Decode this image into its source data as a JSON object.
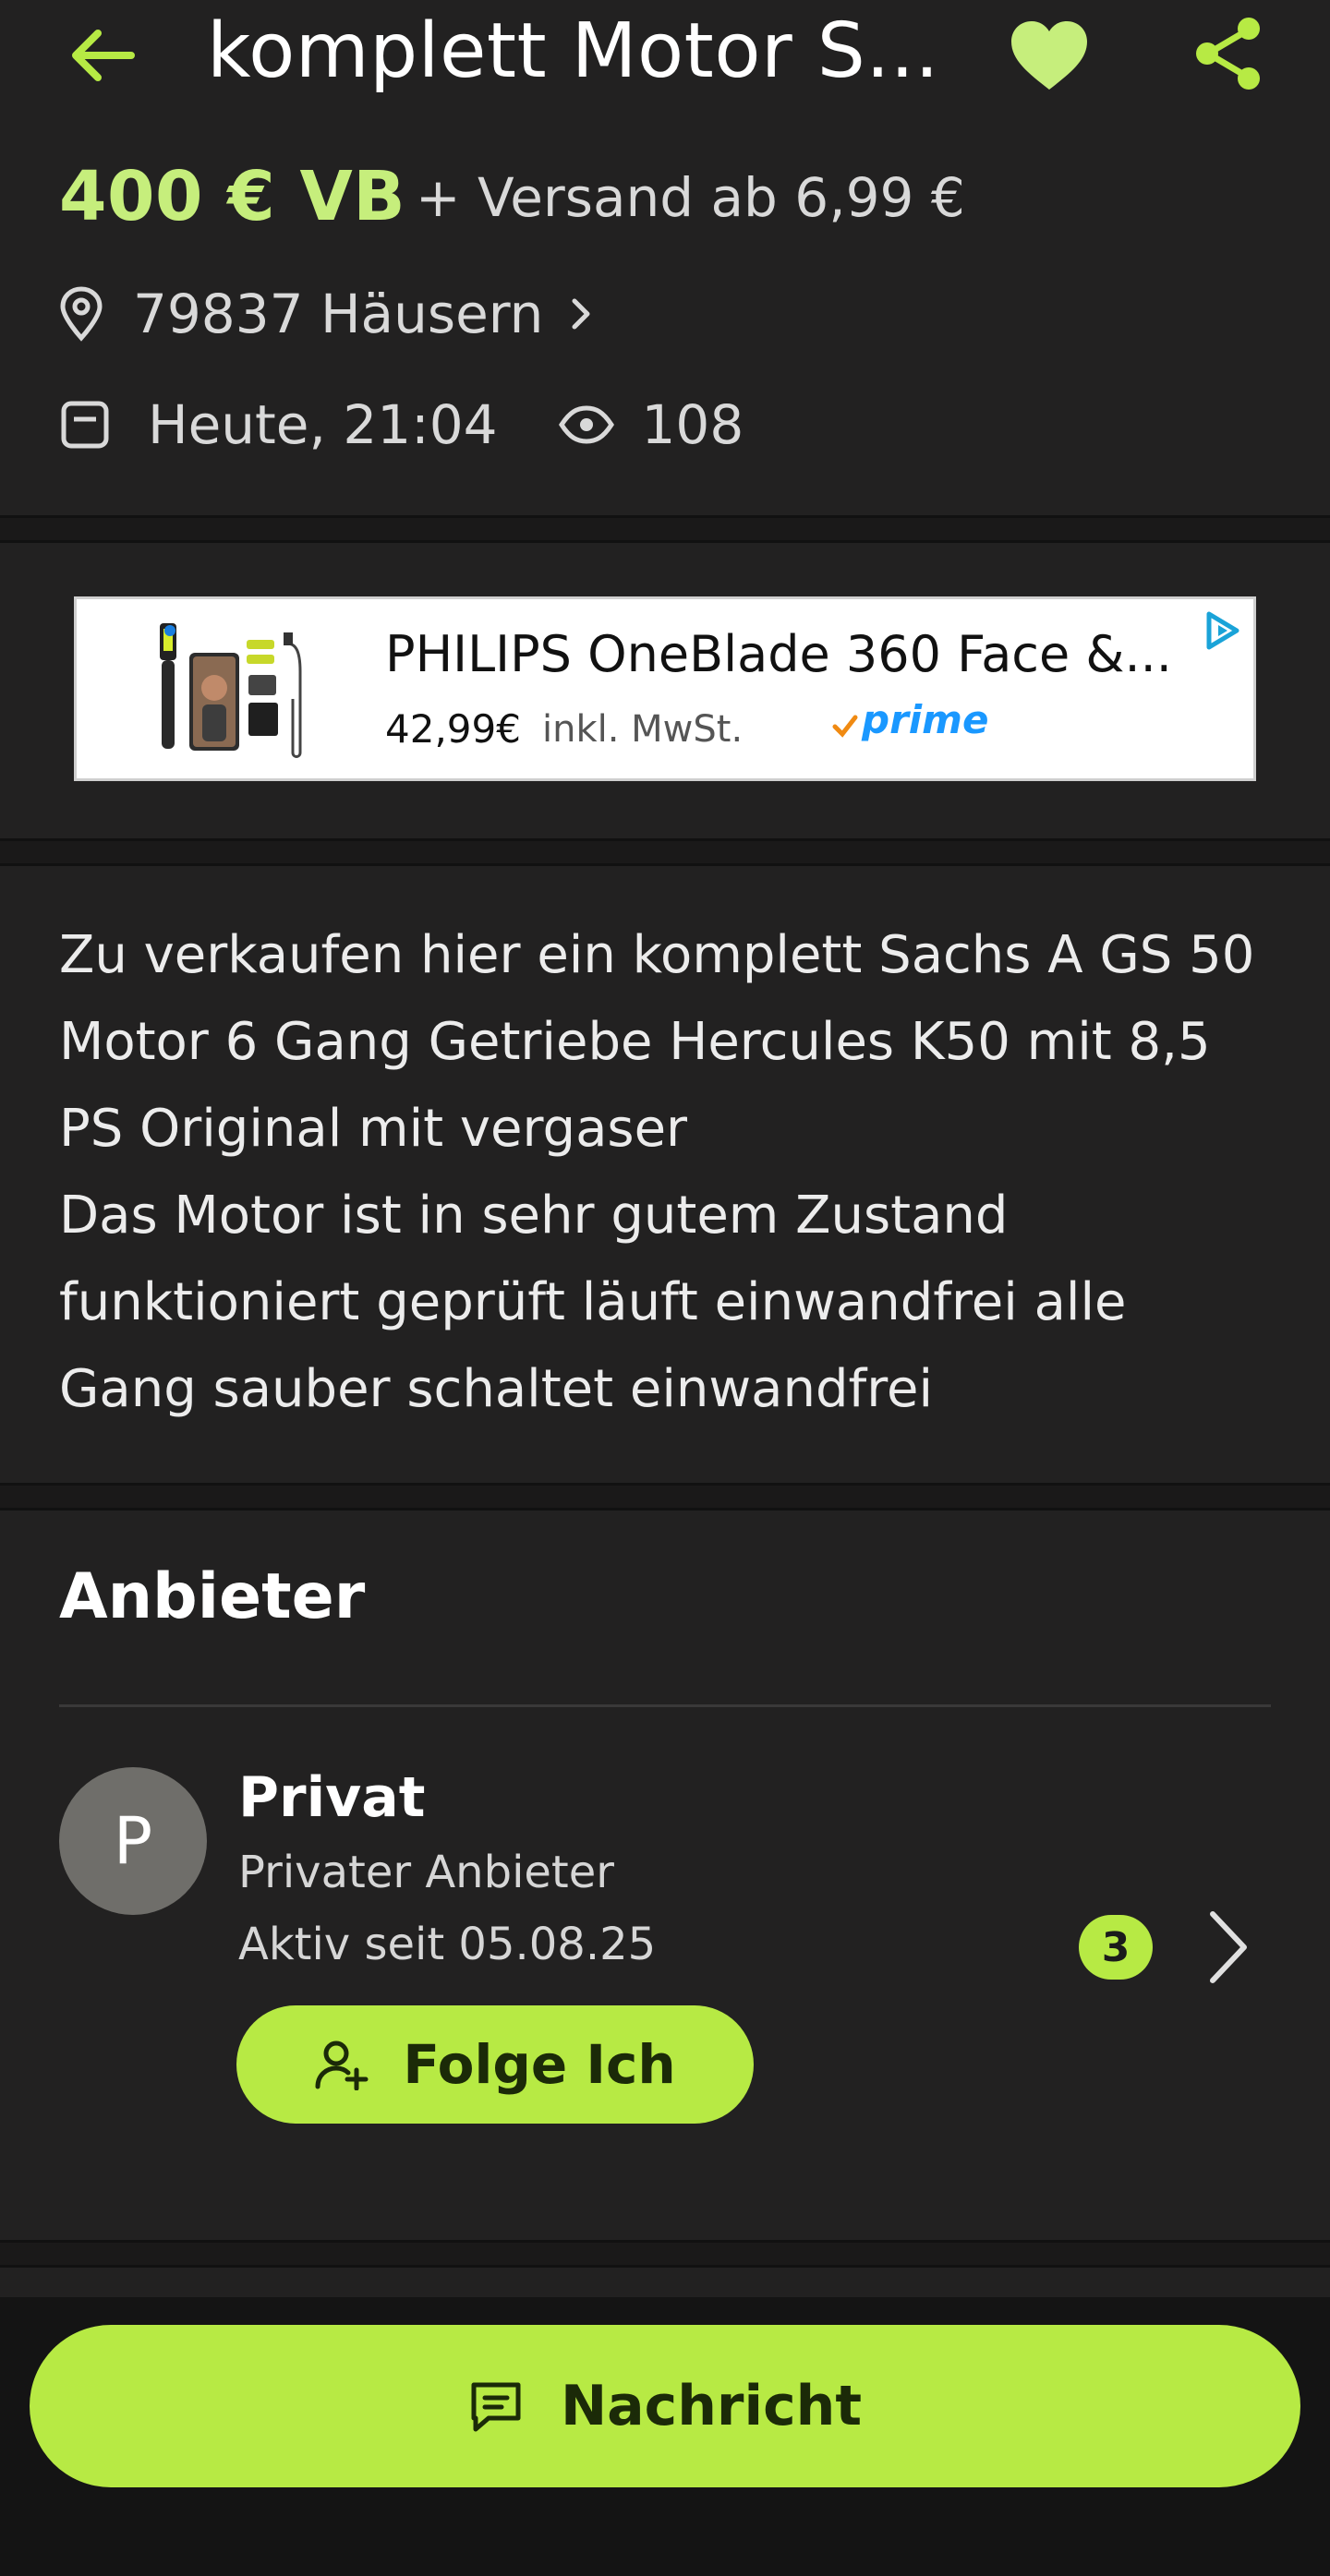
{
  "header": {
    "back_icon": "arrow-left-icon",
    "title": "komplett Motor S...",
    "favorite_icon": "heart-icon",
    "share_icon": "share-icon"
  },
  "listing": {
    "price": "400 € VB",
    "shipping": "+ Versand ab 6,99 €",
    "location": "79837 Häusern",
    "date": "Heute, 21:04",
    "views": "108"
  },
  "ad": {
    "title": "PHILIPS OneBlade 360 Face &...",
    "price": "42,99€",
    "tax_note": "inkl. MwSt.",
    "badge": "prime"
  },
  "description": "Zu verkaufen hier ein komplett Sachs A GS 50 Motor 6 Gang Getriebe Hercules K50 mit 8,5 PS Original mit vergaser\nDas Motor ist in sehr gutem Zustand funktioniert geprüft läuft einwandfrei alle Gang sauber schaltet einwandfrei",
  "seller": {
    "section_title": "Anbieter",
    "avatar_letter": "P",
    "name": "Privat",
    "type": "Privater Anbieter",
    "active_since": "Aktiv seit 05.08.25",
    "badge_count": "3",
    "follow_label": "Folge Ich"
  },
  "footer": {
    "message_label": "Nachricht"
  },
  "colors": {
    "accent": "#b7ea44",
    "price": "#c6ee7c",
    "background": "#222121"
  }
}
